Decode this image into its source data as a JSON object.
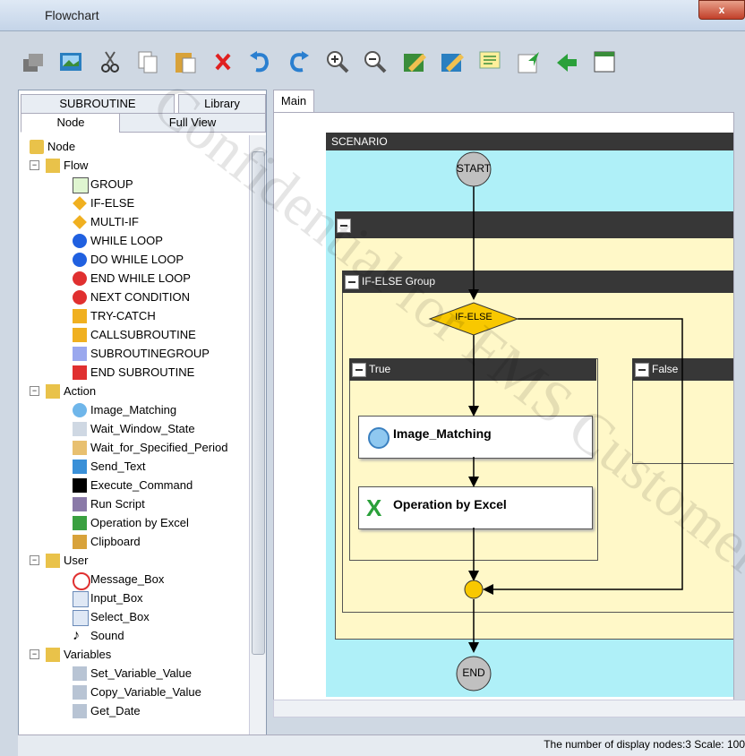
{
  "window": {
    "title": "Flowchart",
    "close_label": "x"
  },
  "toolbar": {
    "icons": [
      "new-node-icon",
      "image-icon",
      "cut-icon",
      "copy-icon",
      "paste-icon",
      "delete-icon",
      "undo-icon",
      "redo-icon",
      "zoom-in-icon",
      "zoom-out-icon",
      "edit-icon",
      "edit2-icon",
      "comment-icon",
      "import-icon",
      "export-icon",
      "window-icon"
    ]
  },
  "left": {
    "tabs": {
      "subroutine": "SUBROUTINE",
      "library": "Library",
      "node": "Node",
      "fullview": "Full View"
    },
    "tree": {
      "root": "Node",
      "flow": {
        "label": "Flow",
        "items": [
          "GROUP",
          "IF-ELSE",
          "MULTI-IF",
          "WHILE LOOP",
          "DO WHILE LOOP",
          "END WHILE LOOP",
          "NEXT CONDITION",
          "TRY-CATCH",
          "CALLSUBROUTINE",
          "SUBROUTINEGROUP",
          "END SUBROUTINE"
        ]
      },
      "action": {
        "label": "Action",
        "items": [
          "Image_Matching",
          "Wait_Window_State",
          "Wait_for_Specified_Period",
          "Send_Text",
          "Execute_Command",
          "Run Script",
          "Operation by Excel",
          "Clipboard"
        ]
      },
      "user": {
        "label": "User",
        "items": [
          "Message_Box",
          "Input_Box",
          "Select_Box",
          "Sound"
        ]
      },
      "variables": {
        "label": "Variables",
        "items": [
          "Set_Variable_Value",
          "Copy_Variable_Value",
          "Get_Date"
        ]
      }
    }
  },
  "main": {
    "tab": "Main",
    "scenario": "SCENARIO",
    "start": "START",
    "end": "END",
    "ifelse_group": "IF-ELSE Group",
    "ifelse": "IF-ELSE",
    "true_branch": "True",
    "false_branch": "False",
    "box1": "Image_Matching",
    "box2": "Operation by Excel"
  },
  "status": {
    "text": "The number of display nodes:3   Scale: 100"
  },
  "watermark": "Confidential for FMS Customer"
}
